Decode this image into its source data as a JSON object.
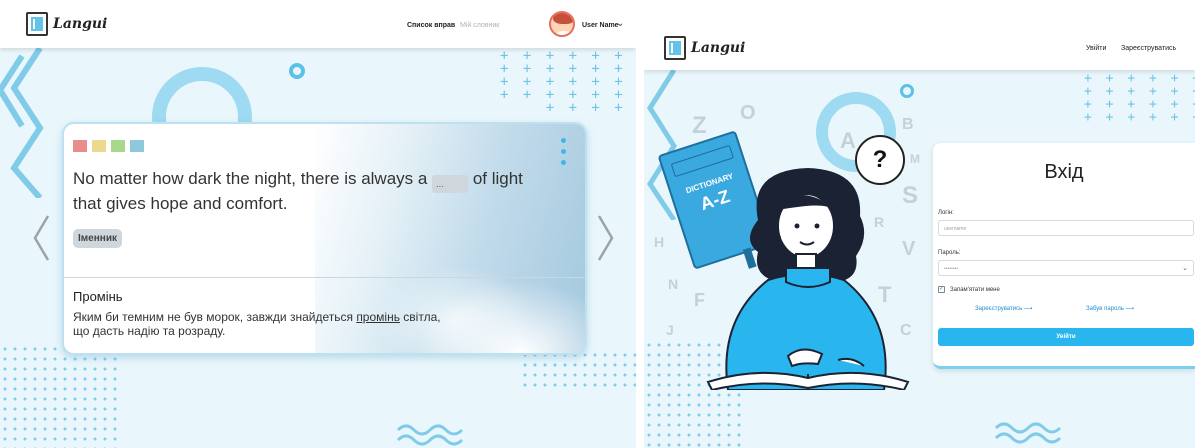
{
  "left_screen": {
    "logo_text": "Langui",
    "nav": {
      "exercises_link": "Список вправ",
      "dictionary_link": "Мій словник",
      "user_name": "User Name",
      "user_menu_chevron": "⌄"
    },
    "card": {
      "swatch_colors": [
        "#e88c8c",
        "#ecd98e",
        "#a8d98a",
        "#8fc7dc"
      ],
      "sentence_before": "No matter how dark the night, there is always a",
      "blank_text": "...",
      "sentence_after": "of light that gives hope and comfort.",
      "part_of_speech": "Іменник",
      "word": "Промінь",
      "translation_before": "Яким би темним не був морок, завжди знайдеться",
      "translation_highlight": "промінь",
      "translation_after": "світла, що дасть надію та розраду."
    },
    "icons": {
      "prev": "chevron-left-icon",
      "next": "chevron-right-icon"
    }
  },
  "right_screen": {
    "logo_text": "Langui",
    "nav": {
      "login_link": "Увійти",
      "register_link": "Зареєструватись"
    },
    "illustration": {
      "book_line1": "DICTIONARY",
      "book_line2": "A-Z",
      "question_mark": "?",
      "letters": [
        "Z",
        "O",
        "A",
        "B",
        "M",
        "S",
        "H",
        "R",
        "V",
        "N",
        "F",
        "J",
        "T",
        "C",
        "E"
      ]
    },
    "login": {
      "title": "Вхід",
      "login_label": "Логін:",
      "login_placeholder": "username",
      "password_label": "Пароль:",
      "password_value": "••••••••",
      "remember_label": "Запам'ятати мене",
      "register_link": "Зареєструватись ⟶",
      "forgot_link": "Забув пароль ⟶",
      "submit_label": "Увійти"
    }
  },
  "colors": {
    "accent": "#29b6ee",
    "background": "#e9f7fc",
    "decor": "#6fc3e6"
  }
}
